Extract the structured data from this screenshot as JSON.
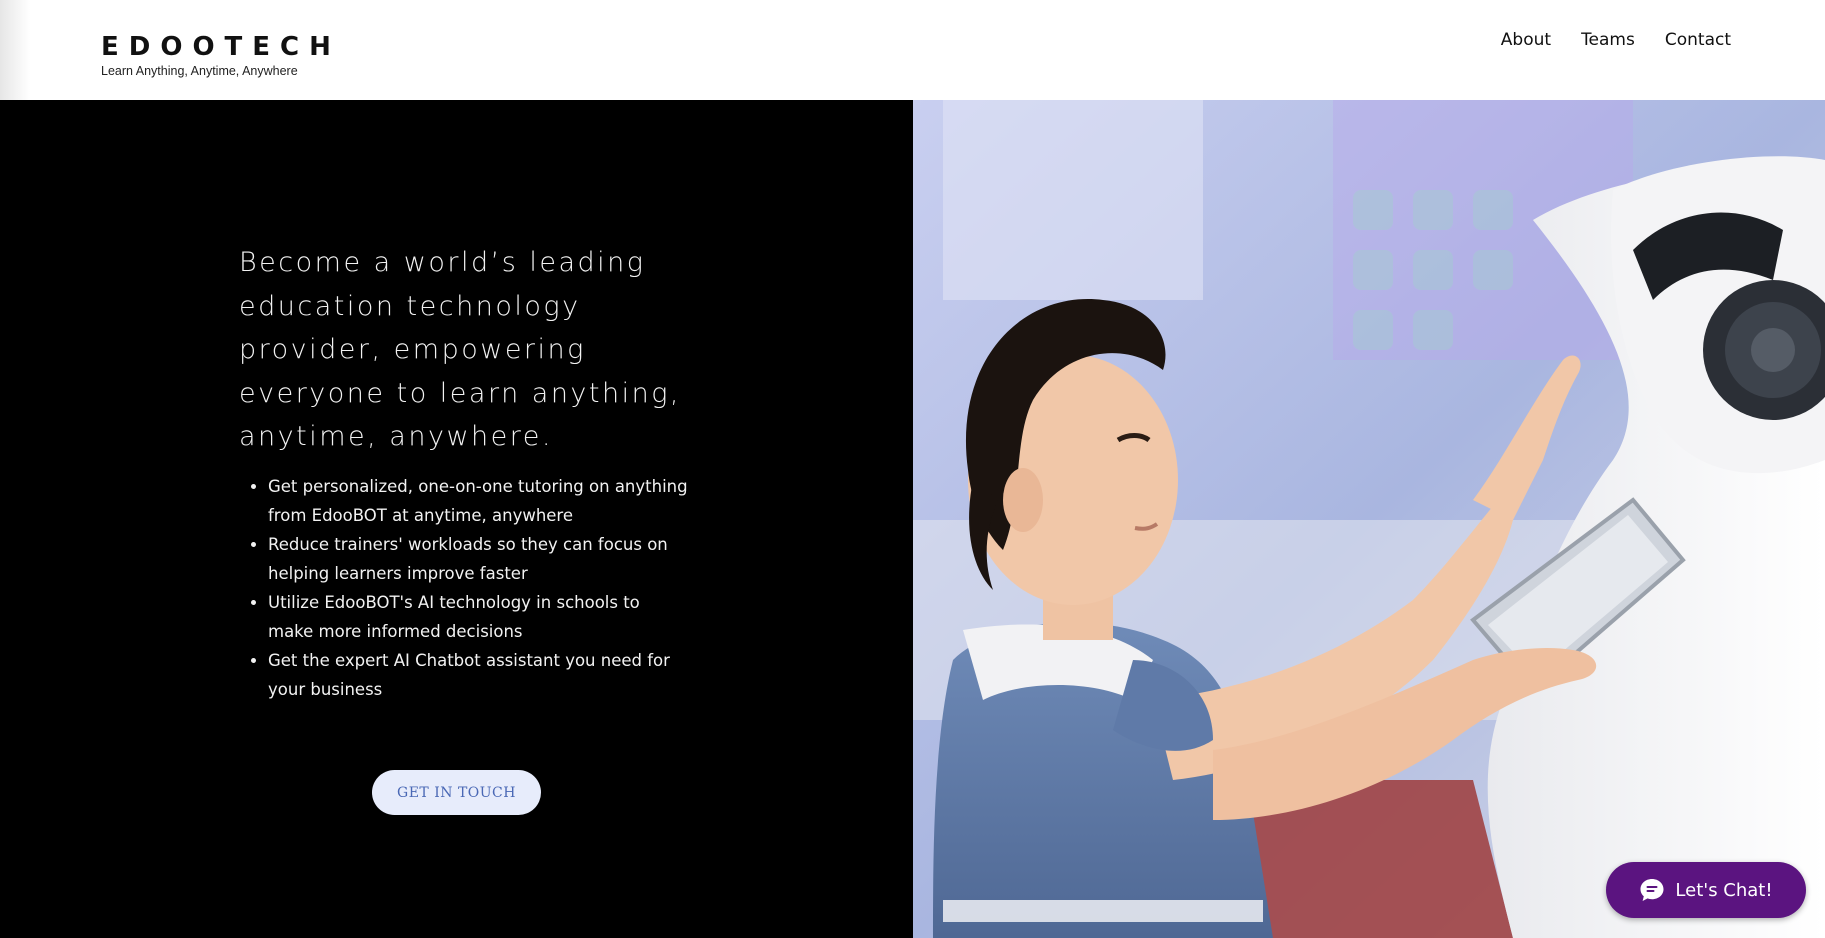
{
  "header": {
    "brand_name": "EDOOTECH",
    "tagline": "Learn Anything, Anytime, Anywhere",
    "nav": [
      {
        "label": "About"
      },
      {
        "label": "Teams"
      },
      {
        "label": "Contact"
      }
    ]
  },
  "hero": {
    "headline": "Become a world’s leading education technology provider, empowering everyone to learn anything, anytime, anywhere.",
    "bullets": [
      "Get personalized, one-on-one tutoring on anything from EdooBOT at anytime, anywhere",
      "Reduce trainers' workloads so they can focus on helping learners improve faster",
      "Utilize EdooBOT's AI technology in schools to make more informed decisions",
      "Get the expert AI Chatbot assistant you need for your business"
    ],
    "cta_label": "GET IN TOUCH"
  },
  "photo": {
    "icon": "photo-girl-robot"
  },
  "chat": {
    "label": "Let's Chat!",
    "icon": "chat-bubble-icon",
    "color": "#5b1480"
  }
}
